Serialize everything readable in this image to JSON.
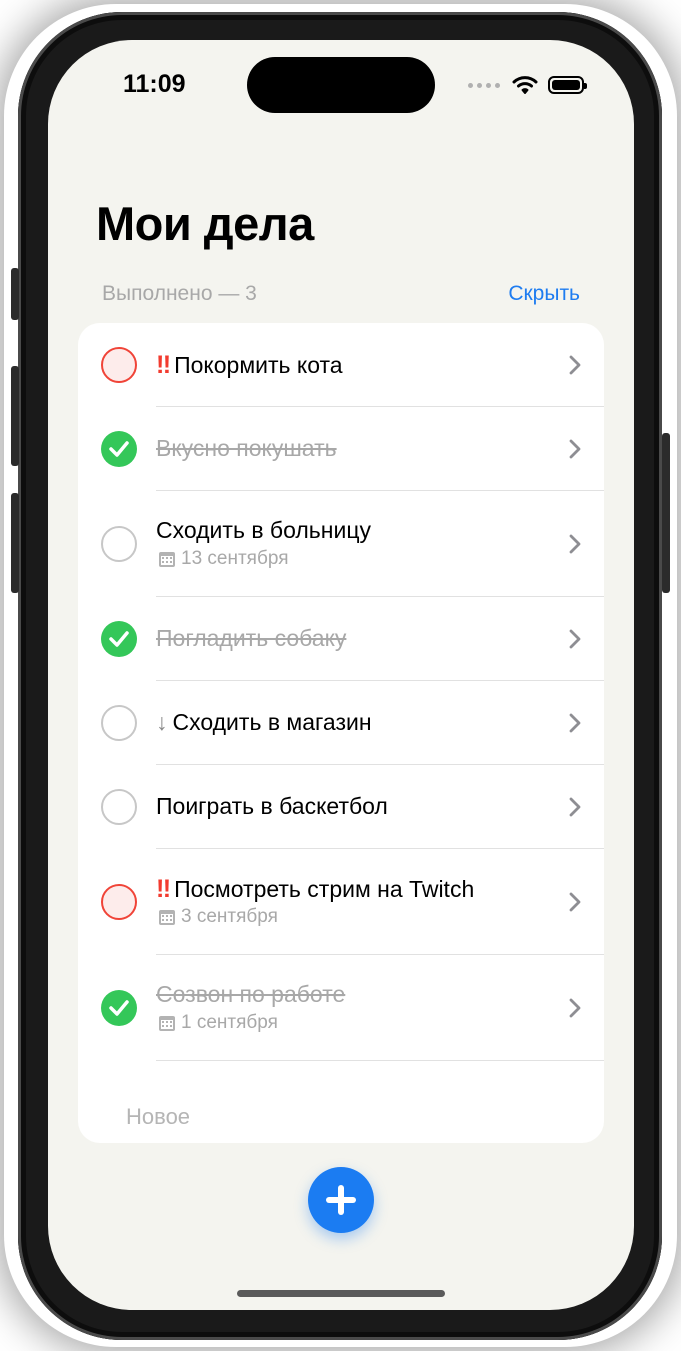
{
  "status_bar": {
    "time": "11:09"
  },
  "header": {
    "title": "Мои дела",
    "done_label": "Выполнено — 3",
    "hide_button": "Скрыть"
  },
  "colors": {
    "accent": "#1b7cf2",
    "done_green": "#34c759",
    "high_priority_red": "#f04438",
    "background": "#f4f4ef"
  },
  "tasks": [
    {
      "title": "Покормить кота",
      "status": "high_priority",
      "prefix": "‼",
      "date": ""
    },
    {
      "title": "Вкусно покушать",
      "status": "done",
      "prefix": "",
      "date": ""
    },
    {
      "title": "Сходить в больницу",
      "status": "normal",
      "prefix": "",
      "date": "13 сентября"
    },
    {
      "title": "Погладить собаку",
      "status": "done",
      "prefix": "",
      "date": ""
    },
    {
      "title": "Сходить в магазин",
      "status": "low_priority",
      "prefix": "↓",
      "date": ""
    },
    {
      "title": "Поиграть в баскетбол",
      "status": "normal",
      "prefix": "",
      "date": ""
    },
    {
      "title": "Посмотреть стрим на Twitch",
      "status": "high_priority",
      "prefix": "‼",
      "date": "3 сентября"
    },
    {
      "title": "Созвон по работе",
      "status": "done",
      "prefix": "",
      "date": "1 сентября"
    }
  ],
  "new_item_placeholder": "Новое",
  "icons": {
    "chevron": "chevron-right-icon",
    "calendar": "calendar-icon",
    "add": "plus-icon"
  }
}
